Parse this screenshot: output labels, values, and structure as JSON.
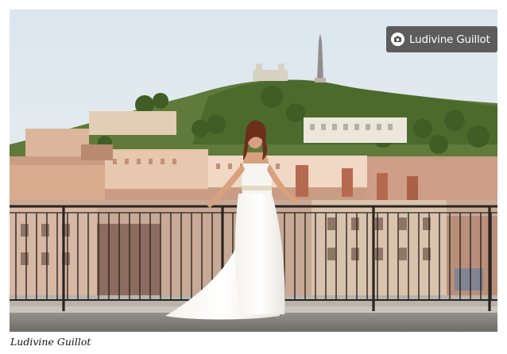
{
  "photo": {
    "scene": "photo",
    "credit_badge": {
      "label": "Ludivine Guillot",
      "icon": "camera-icon"
    }
  },
  "caption": "Ludivine Guillot"
}
